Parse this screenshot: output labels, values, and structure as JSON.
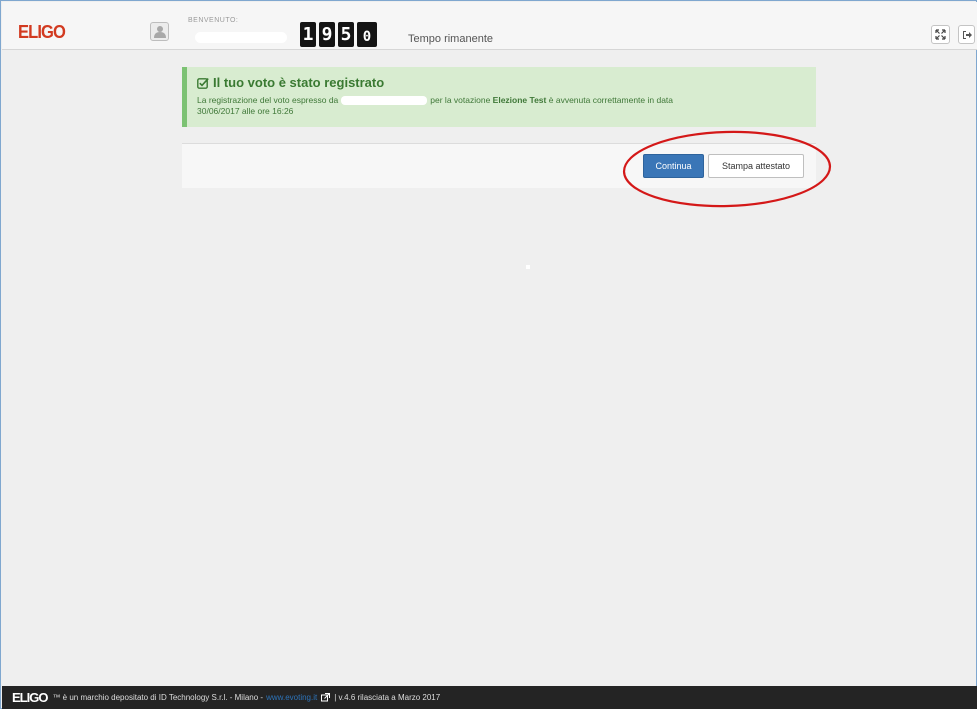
{
  "header": {
    "logo_text": "ELIGO",
    "welcome_label": "BENVENUTO:",
    "timer_digits": [
      "1",
      "9",
      "5",
      "0"
    ],
    "timer_label": "Tempo rimanente"
  },
  "toolbar": {
    "fullscreen_icon": "expand-icon",
    "logout_icon": "logout-icon"
  },
  "alert": {
    "title": "Il tuo voto è stato registrato",
    "text_part1": "La registrazione del voto espresso da",
    "text_part2": "per la votazione",
    "election_name": "Elezione Test",
    "text_part3": "è avvenuta correttamente in data",
    "text_line2": "30/06/2017 alle ore 16:26"
  },
  "actions": {
    "continue_label": "Continua",
    "print_label": "Stampa attestato"
  },
  "footer": {
    "logo_text": "ELIGO",
    "trademark_text": "™ è un marchio depositato di ID Technology S.r.l. - Milano -",
    "link_text": "www.evoting.it",
    "version_text": "| v.4.6 rilasciata a Marzo 2017"
  },
  "colors": {
    "brand": "#d23a20",
    "primary_button": "#3a76b7",
    "alert_background": "#d8ecd0",
    "alert_text": "#3a7a32",
    "annotation": "#d41818"
  }
}
